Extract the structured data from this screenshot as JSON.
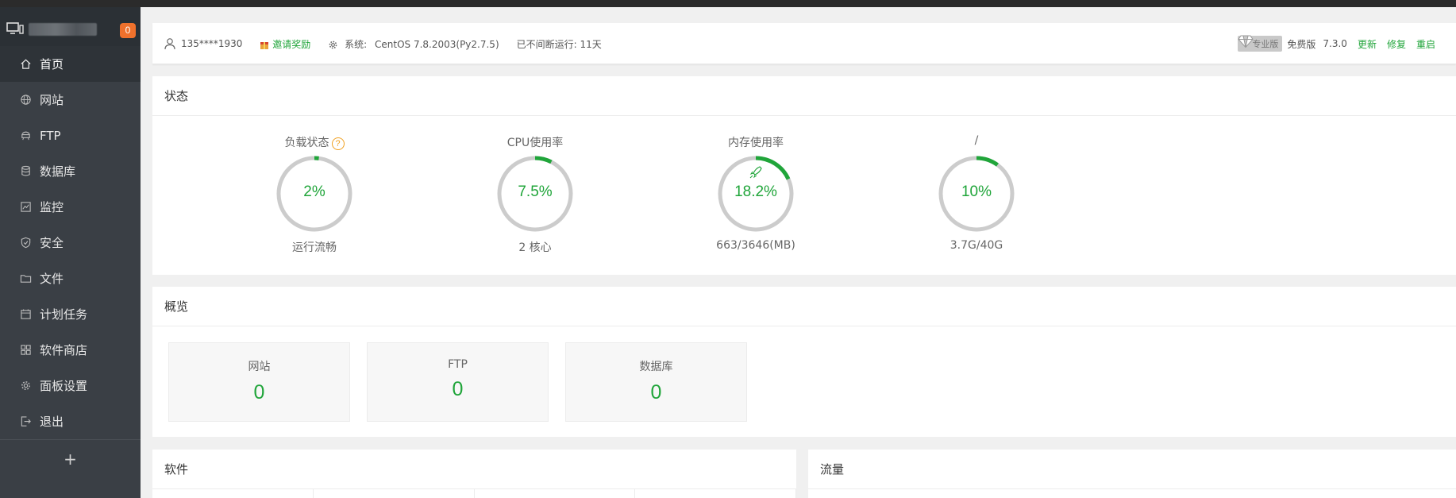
{
  "sidebar": {
    "badge": "0",
    "items": [
      {
        "label": "首页",
        "icon": "home-icon",
        "active": true
      },
      {
        "label": "网站",
        "icon": "globe-icon"
      },
      {
        "label": "FTP",
        "icon": "ftp-icon"
      },
      {
        "label": "数据库",
        "icon": "database-icon"
      },
      {
        "label": "监控",
        "icon": "monitor-icon"
      },
      {
        "label": "安全",
        "icon": "shield-icon"
      },
      {
        "label": "文件",
        "icon": "folder-icon"
      },
      {
        "label": "计划任务",
        "icon": "calendar-icon"
      },
      {
        "label": "软件商店",
        "icon": "grid-icon"
      },
      {
        "label": "面板设置",
        "icon": "gear-icon"
      },
      {
        "label": "退出",
        "icon": "logout-icon"
      }
    ],
    "add_label": "+"
  },
  "topbar": {
    "user": "135****1930",
    "invite": "邀请奖励",
    "system_label": "系统:",
    "system_value": "CentOS 7.8.2003(Py2.7.5)",
    "uptime": "已不间断运行: 11天",
    "pro_tag": "专业版",
    "edition": "免费版",
    "version": "7.3.0",
    "update": "更新",
    "repair": "修复",
    "restart": "重启"
  },
  "status": {
    "title": "状态",
    "gauges": [
      {
        "title": "负载状态",
        "value": "2%",
        "percent": 2,
        "sub": "运行流畅",
        "help": "?"
      },
      {
        "title": "CPU使用率",
        "value": "7.5%",
        "percent": 7.5,
        "sub": "2 核心"
      },
      {
        "title": "内存使用率",
        "value": "18.2%",
        "percent": 18.2,
        "sub": "663/3646(MB)",
        "rocket": true
      },
      {
        "title": "/",
        "value": "10%",
        "percent": 10,
        "sub": "3.7G/40G"
      }
    ]
  },
  "overview": {
    "title": "概览",
    "cards": [
      {
        "label": "网站",
        "value": "0"
      },
      {
        "label": "FTP",
        "value": "0"
      },
      {
        "label": "数据库",
        "value": "0"
      }
    ]
  },
  "software": {
    "title": "软件"
  },
  "traffic": {
    "title": "流量"
  },
  "colors": {
    "accent": "#20a53a",
    "sidebar": "#3a3f45",
    "badge": "#f0712c",
    "ring_track": "#cccccc"
  }
}
